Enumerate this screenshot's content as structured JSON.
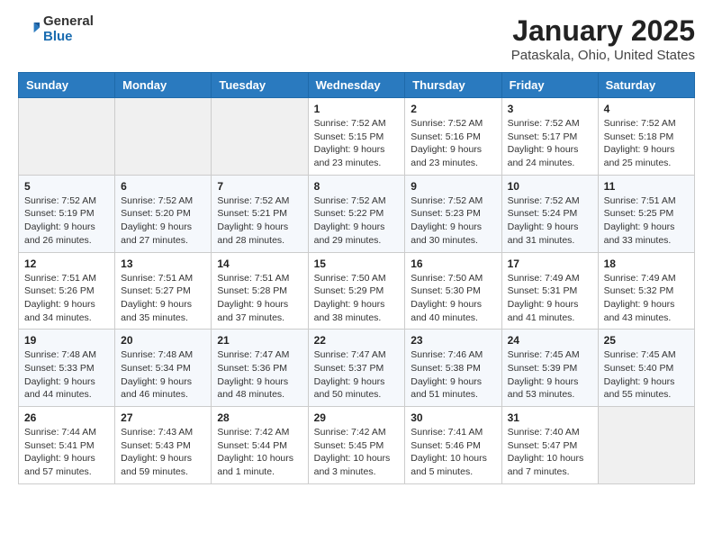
{
  "header": {
    "logo_general": "General",
    "logo_blue": "Blue",
    "title": "January 2025",
    "subtitle": "Pataskala, Ohio, United States"
  },
  "days_of_week": [
    "Sunday",
    "Monday",
    "Tuesday",
    "Wednesday",
    "Thursday",
    "Friday",
    "Saturday"
  ],
  "weeks": [
    {
      "days": [
        {
          "num": "",
          "info": ""
        },
        {
          "num": "",
          "info": ""
        },
        {
          "num": "",
          "info": ""
        },
        {
          "num": "1",
          "sunrise": "7:52 AM",
          "sunset": "5:15 PM",
          "daylight": "9 hours and 23 minutes."
        },
        {
          "num": "2",
          "sunrise": "7:52 AM",
          "sunset": "5:16 PM",
          "daylight": "9 hours and 23 minutes."
        },
        {
          "num": "3",
          "sunrise": "7:52 AM",
          "sunset": "5:17 PM",
          "daylight": "9 hours and 24 minutes."
        },
        {
          "num": "4",
          "sunrise": "7:52 AM",
          "sunset": "5:18 PM",
          "daylight": "9 hours and 25 minutes."
        }
      ]
    },
    {
      "days": [
        {
          "num": "5",
          "sunrise": "7:52 AM",
          "sunset": "5:19 PM",
          "daylight": "9 hours and 26 minutes."
        },
        {
          "num": "6",
          "sunrise": "7:52 AM",
          "sunset": "5:20 PM",
          "daylight": "9 hours and 27 minutes."
        },
        {
          "num": "7",
          "sunrise": "7:52 AM",
          "sunset": "5:21 PM",
          "daylight": "9 hours and 28 minutes."
        },
        {
          "num": "8",
          "sunrise": "7:52 AM",
          "sunset": "5:22 PM",
          "daylight": "9 hours and 29 minutes."
        },
        {
          "num": "9",
          "sunrise": "7:52 AM",
          "sunset": "5:23 PM",
          "daylight": "9 hours and 30 minutes."
        },
        {
          "num": "10",
          "sunrise": "7:52 AM",
          "sunset": "5:24 PM",
          "daylight": "9 hours and 31 minutes."
        },
        {
          "num": "11",
          "sunrise": "7:51 AM",
          "sunset": "5:25 PM",
          "daylight": "9 hours and 33 minutes."
        }
      ]
    },
    {
      "days": [
        {
          "num": "12",
          "sunrise": "7:51 AM",
          "sunset": "5:26 PM",
          "daylight": "9 hours and 34 minutes."
        },
        {
          "num": "13",
          "sunrise": "7:51 AM",
          "sunset": "5:27 PM",
          "daylight": "9 hours and 35 minutes."
        },
        {
          "num": "14",
          "sunrise": "7:51 AM",
          "sunset": "5:28 PM",
          "daylight": "9 hours and 37 minutes."
        },
        {
          "num": "15",
          "sunrise": "7:50 AM",
          "sunset": "5:29 PM",
          "daylight": "9 hours and 38 minutes."
        },
        {
          "num": "16",
          "sunrise": "7:50 AM",
          "sunset": "5:30 PM",
          "daylight": "9 hours and 40 minutes."
        },
        {
          "num": "17",
          "sunrise": "7:49 AM",
          "sunset": "5:31 PM",
          "daylight": "9 hours and 41 minutes."
        },
        {
          "num": "18",
          "sunrise": "7:49 AM",
          "sunset": "5:32 PM",
          "daylight": "9 hours and 43 minutes."
        }
      ]
    },
    {
      "days": [
        {
          "num": "19",
          "sunrise": "7:48 AM",
          "sunset": "5:33 PM",
          "daylight": "9 hours and 44 minutes."
        },
        {
          "num": "20",
          "sunrise": "7:48 AM",
          "sunset": "5:34 PM",
          "daylight": "9 hours and 46 minutes."
        },
        {
          "num": "21",
          "sunrise": "7:47 AM",
          "sunset": "5:36 PM",
          "daylight": "9 hours and 48 minutes."
        },
        {
          "num": "22",
          "sunrise": "7:47 AM",
          "sunset": "5:37 PM",
          "daylight": "9 hours and 50 minutes."
        },
        {
          "num": "23",
          "sunrise": "7:46 AM",
          "sunset": "5:38 PM",
          "daylight": "9 hours and 51 minutes."
        },
        {
          "num": "24",
          "sunrise": "7:45 AM",
          "sunset": "5:39 PM",
          "daylight": "9 hours and 53 minutes."
        },
        {
          "num": "25",
          "sunrise": "7:45 AM",
          "sunset": "5:40 PM",
          "daylight": "9 hours and 55 minutes."
        }
      ]
    },
    {
      "days": [
        {
          "num": "26",
          "sunrise": "7:44 AM",
          "sunset": "5:41 PM",
          "daylight": "9 hours and 57 minutes."
        },
        {
          "num": "27",
          "sunrise": "7:43 AM",
          "sunset": "5:43 PM",
          "daylight": "9 hours and 59 minutes."
        },
        {
          "num": "28",
          "sunrise": "7:42 AM",
          "sunset": "5:44 PM",
          "daylight": "10 hours and 1 minute."
        },
        {
          "num": "29",
          "sunrise": "7:42 AM",
          "sunset": "5:45 PM",
          "daylight": "10 hours and 3 minutes."
        },
        {
          "num": "30",
          "sunrise": "7:41 AM",
          "sunset": "5:46 PM",
          "daylight": "10 hours and 5 minutes."
        },
        {
          "num": "31",
          "sunrise": "7:40 AM",
          "sunset": "5:47 PM",
          "daylight": "10 hours and 7 minutes."
        },
        {
          "num": "",
          "info": ""
        }
      ]
    }
  ],
  "labels": {
    "sunrise": "Sunrise:",
    "sunset": "Sunset:",
    "daylight": "Daylight:"
  }
}
